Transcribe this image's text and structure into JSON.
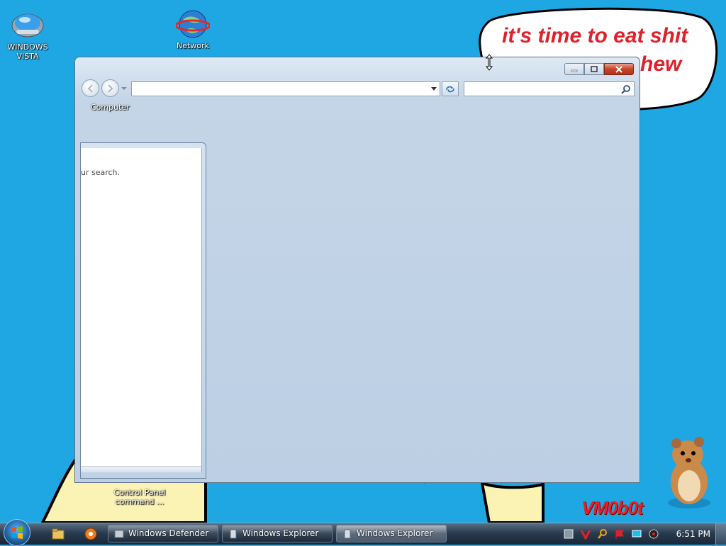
{
  "desktop": {
    "icons": [
      {
        "label": "WINDOWS\nVISTA",
        "icon": "vista-drive-icon"
      },
      {
        "label": "Network",
        "icon": "network-globe-icon"
      }
    ],
    "speech_bubble": {
      "line1": "it's time to eat shit",
      "line2": "hew"
    },
    "ghost_labels": {
      "control_panel": "Control Panel\ncommand ..."
    },
    "signature": "VM0b0t"
  },
  "explorer": {
    "breadcrumb": "Computer",
    "address_value": "",
    "search_value": "",
    "buttons": [
      "minimize",
      "maximize",
      "close"
    ]
  },
  "search_panel": {
    "hint_text": "ur search."
  },
  "taskbar": {
    "windows": [
      {
        "label": "Windows Defender",
        "icon": "defender-icon",
        "active": false
      },
      {
        "label": "Windows Explorer",
        "icon": "explorer-icon",
        "active": false
      },
      {
        "label": "Windows Explorer",
        "icon": "explorer-icon",
        "active": true
      }
    ],
    "quick_launch": [
      "explorer-folder-icon",
      "media-icon"
    ],
    "tray_icons": [
      "network-status-icon",
      "antivirus-icon",
      "search-tray-icon",
      "flag-icon",
      "display-icon",
      "volume-icon"
    ],
    "clock": "6:51 PM"
  },
  "colors": {
    "desktop_bg": "#1fa7e4",
    "accent_red": "#e0202a",
    "hair_yellow": "#f7f000",
    "skin": "#fbf3b4"
  }
}
